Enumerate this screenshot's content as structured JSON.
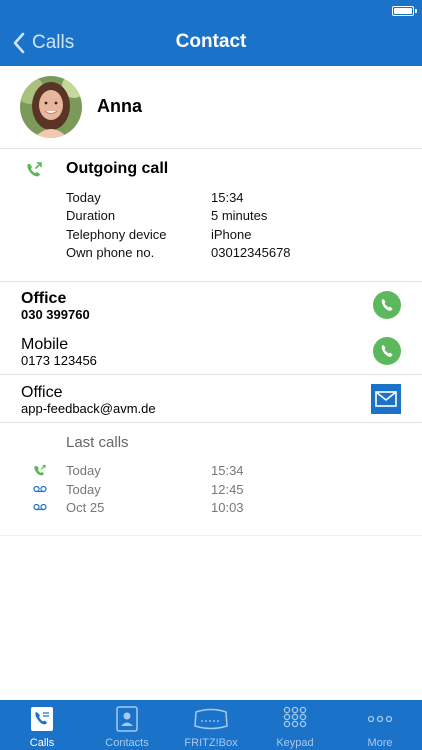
{
  "header": {
    "back_label": "Calls",
    "title": "Contact"
  },
  "contact": {
    "name": "Anna"
  },
  "call": {
    "title": "Outgoing call",
    "details": [
      {
        "label": "Today",
        "value": "15:34"
      },
      {
        "label": "Duration",
        "value": "5 minutes"
      },
      {
        "label": "Telephony device",
        "value": "iPhone"
      },
      {
        "label": "Own phone no.",
        "value": "03012345678"
      }
    ]
  },
  "numbers": [
    {
      "label": "Office",
      "value": "030 399760",
      "action": "phone-icon"
    },
    {
      "label": "Mobile",
      "value": "0173 123456",
      "action": "phone-icon"
    },
    {
      "label": "Office",
      "value": "app-feedback@avm.de",
      "action": "mail-icon"
    }
  ],
  "last_calls": {
    "title": "Last calls",
    "items": [
      {
        "type": "outgoing-call-icon",
        "date": "Today",
        "time": "15:34"
      },
      {
        "type": "voicemail-icon",
        "date": "Today",
        "time": "12:45"
      },
      {
        "type": "voicemail-icon",
        "date": "Oct 25",
        "time": "10:03"
      }
    ]
  },
  "tabbar": {
    "tabs": [
      {
        "label": "Calls",
        "icon": "calls-icon",
        "active": true
      },
      {
        "label": "Contacts",
        "icon": "contacts-icon",
        "active": false
      },
      {
        "label": "FRITZ!Box",
        "icon": "fritzbox-icon",
        "active": false
      },
      {
        "label": "Keypad",
        "icon": "keypad-icon",
        "active": false
      },
      {
        "label": "More",
        "icon": "more-icon",
        "active": false
      }
    ]
  },
  "colors": {
    "accent": "#1a73c8",
    "call_green": "#5cb85c"
  }
}
